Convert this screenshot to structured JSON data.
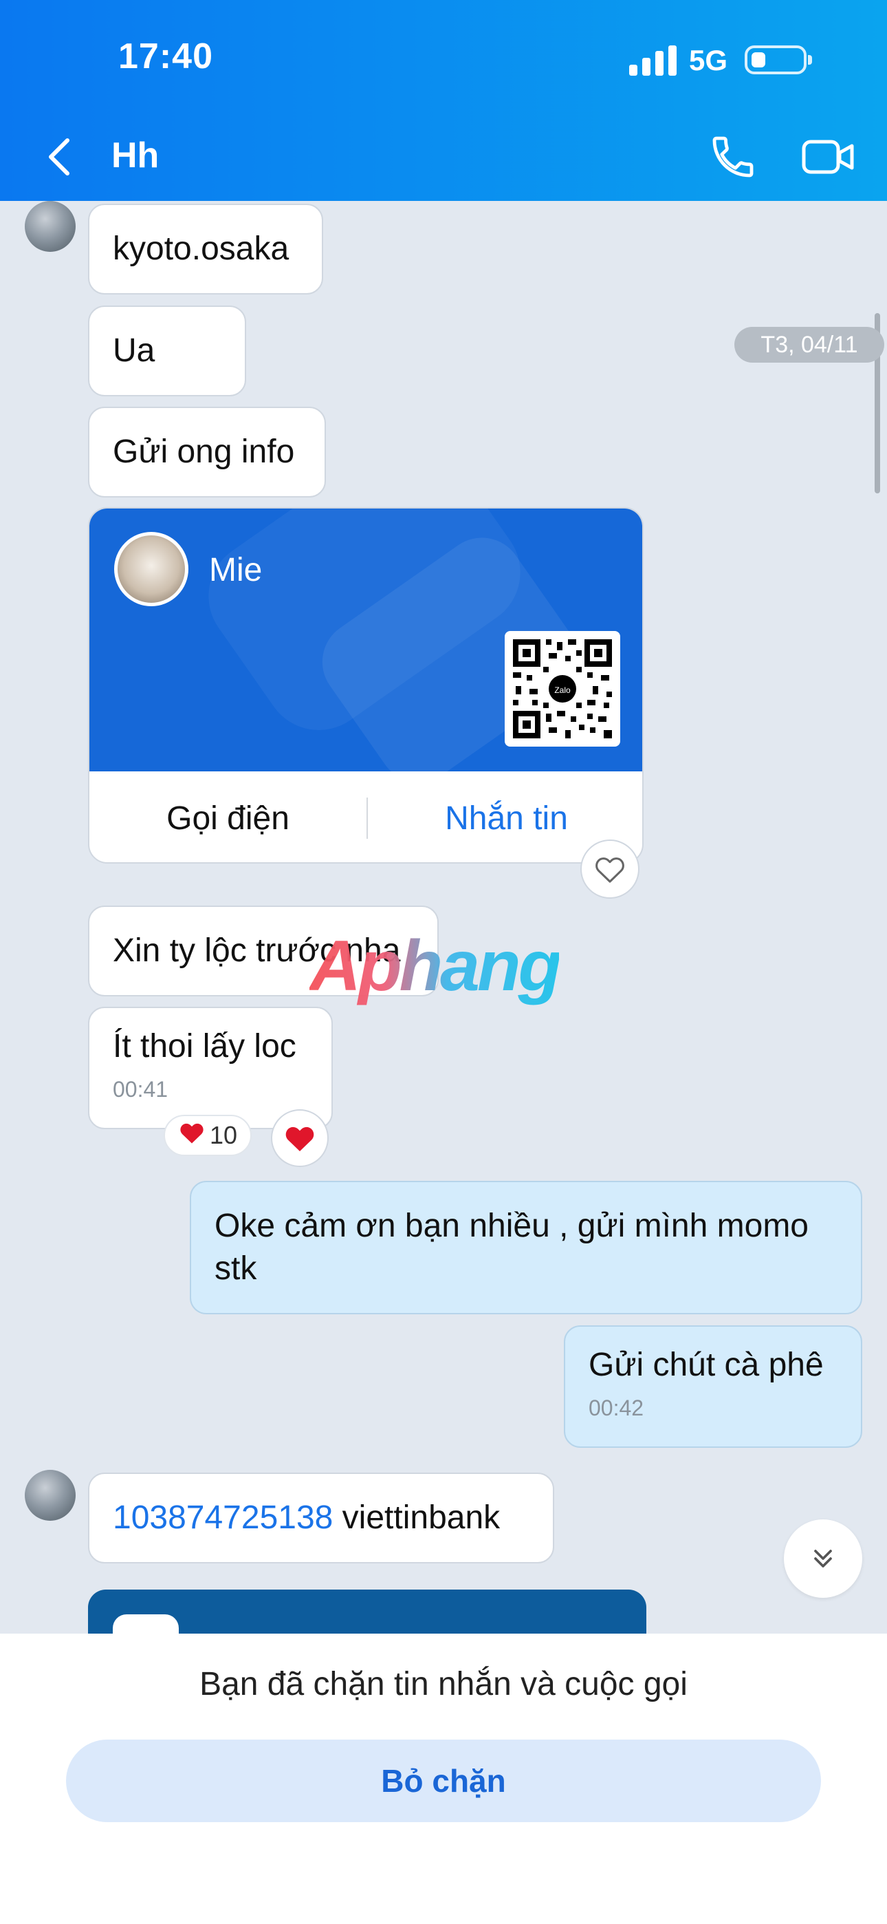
{
  "status_bar": {
    "time": "17:40",
    "network": "5G"
  },
  "header": {
    "title": "Hh"
  },
  "date_separator": "T3, 04/11",
  "messages": {
    "m1": "kyoto.osaka",
    "m2": "Ua",
    "m3": "Gửi ong info",
    "contact_card": {
      "name": "Mie",
      "call_label": "Gọi điện",
      "message_label": "Nhắn tin"
    },
    "m4": "Xin ty lộc trước nha",
    "m5": {
      "text": "Ít thoi lấy loc",
      "time": "00:41",
      "reaction_count": "10"
    },
    "m6": "Oke cảm ơn bạn nhiều , gửi mình momo stk",
    "m7": {
      "text": "Gửi chút cà phê",
      "time": "00:42"
    },
    "m8": {
      "account": "103874725138",
      "bank": " viettinbank"
    }
  },
  "watermark": "Aphang",
  "footer": {
    "blocked_text": "Bạn đã chặn tin nhắn và cuộc gọi",
    "unblock_label": "Bỏ chặn"
  },
  "colors": {
    "header": "#0a8ff0",
    "link": "#1a73e8",
    "outgoing_bubble": "#d4ecfc",
    "heart": "#e0162b"
  },
  "icons": [
    "back-icon",
    "phone-icon",
    "video-call-icon",
    "heart-icon",
    "chevron-double-down-icon"
  ]
}
